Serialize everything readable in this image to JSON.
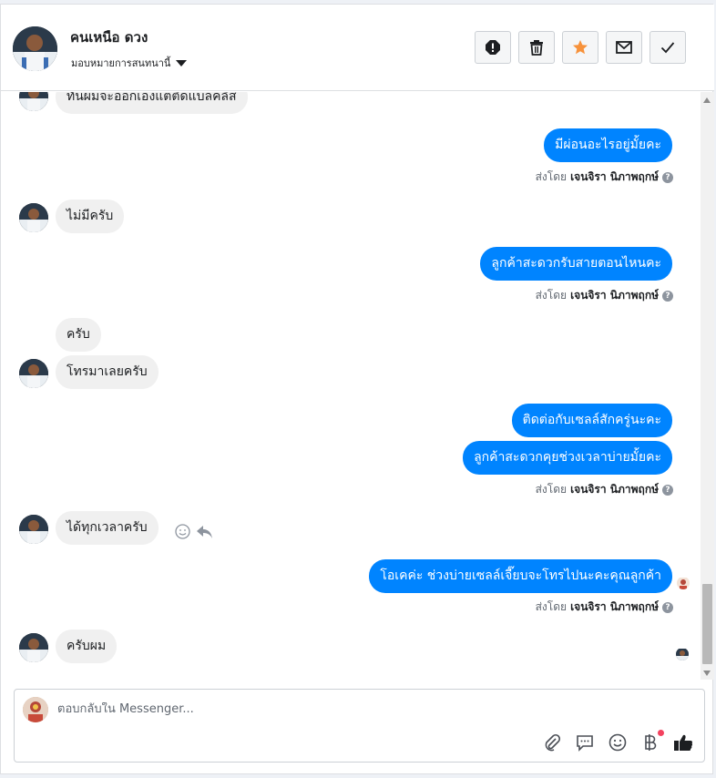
{
  "header": {
    "contact_name": "คนเหนือ ดวง",
    "assign_label": "มอบหมายการสนทนานี้",
    "actions": [
      "mark-spam",
      "delete",
      "star",
      "mark-unread",
      "mark-done"
    ]
  },
  "messages": [
    {
      "dir": "in",
      "text": "ทันผมจะออกเองแต่ติดแบลคลิส"
    },
    {
      "dir": "out",
      "text": "มีผ่อนอะไรอยู่มั้ยคะ"
    },
    {
      "dir": "meta",
      "prefix": "ส่งโดย",
      "sender": "เจนจิรา นิภาพฤกษ์"
    },
    {
      "dir": "in",
      "text": "ไม่มีครับ"
    },
    {
      "dir": "out",
      "text": "ลูกค้าสะดวกรับสายตอนไหนคะ"
    },
    {
      "dir": "meta",
      "prefix": "ส่งโดย",
      "sender": "เจนจิรา นิภาพฤกษ์"
    },
    {
      "dir": "in",
      "text": "ครับ"
    },
    {
      "dir": "in",
      "text": "โทรมาเลยครับ"
    },
    {
      "dir": "out",
      "text": "ติดต่อกับเซลล์สักครู่นะคะ"
    },
    {
      "dir": "out",
      "text": "ลูกค้าสะดวกคุยช่วงเวลาบ่ายมั้ยคะ"
    },
    {
      "dir": "meta",
      "prefix": "ส่งโดย",
      "sender": "เจนจิรา นิภาพฤกษ์"
    },
    {
      "dir": "in",
      "text": "ได้ทุกเวลาครับ"
    },
    {
      "dir": "out",
      "text": "โอเคค่ะ ช่วงบ่ายเซลล์เจี๊ยบจะโทรไปนะคะคุณลูกค้า"
    },
    {
      "dir": "meta",
      "prefix": "ส่งโดย",
      "sender": "เจนจิรา นิภาพฤกษ์"
    },
    {
      "dir": "in",
      "text": "ครับผม"
    }
  ],
  "composer": {
    "placeholder": "ตอบกลับใน Messenger...",
    "tools": [
      "paperclip-icon",
      "chat-bubble-icon",
      "smiley-icon",
      "baht-icon",
      "thumbs-up-icon"
    ]
  },
  "colors": {
    "accent": "#0084ff",
    "star": "#f7923b",
    "incoming_bubble": "#f0f0f0",
    "notification_dot": "#f3425f"
  }
}
